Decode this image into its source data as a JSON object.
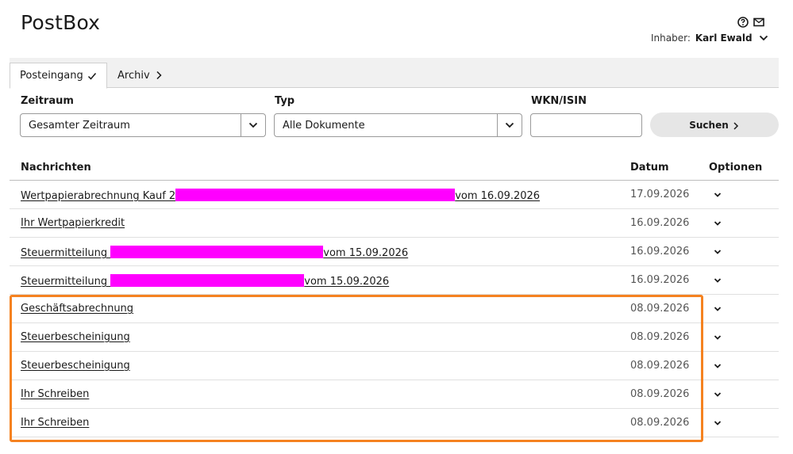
{
  "app": {
    "title": "PostBox"
  },
  "header": {
    "icons": [
      "help-icon",
      "mail-icon"
    ],
    "owner_label": "Inhaber:",
    "owner_name": "Karl Ewald"
  },
  "tabs": [
    {
      "label": "Posteingang",
      "active": true,
      "icon": "check-icon"
    },
    {
      "label": "Archiv",
      "active": false,
      "icon": "chevron-right-icon"
    }
  ],
  "filters": {
    "zeitraum": {
      "label": "Zeitraum",
      "value": "Gesamter Zeitraum"
    },
    "typ": {
      "label": "Typ",
      "value": "Alle Dokumente"
    },
    "wkn": {
      "label": "WKN/ISIN",
      "value": ""
    },
    "search_label": "Suchen"
  },
  "table": {
    "headers": {
      "messages": "Nachrichten",
      "date": "Datum",
      "options": "Optionen"
    },
    "rows": [
      {
        "pre": "Wertpapierabrechnung Kauf 2",
        "redacted": true,
        "post": "vom 16.09.2026",
        "date": "17.09.2026"
      },
      {
        "pre": "Ihr Wertpapierkredit",
        "redacted": false,
        "post": "",
        "date": "16.09.2026"
      },
      {
        "pre": "Steuermitteilung ",
        "redacted": true,
        "post": "vom 15.09.2026",
        "date": "16.09.2026"
      },
      {
        "pre": "Steuermitteilung ",
        "redacted": true,
        "post": "vom 15.09.2026",
        "date": "16.09.2026"
      },
      {
        "pre": "Geschäftsabrechnung",
        "redacted": false,
        "post": "",
        "date": "08.09.2026"
      },
      {
        "pre": "Steuerbescheinigung",
        "redacted": false,
        "post": "",
        "date": "08.09.2026"
      },
      {
        "pre": "Steuerbescheinigung",
        "redacted": false,
        "post": "",
        "date": "08.09.2026"
      },
      {
        "pre": "Ihr Schreiben",
        "redacted": false,
        "post": "",
        "date": "08.09.2026"
      },
      {
        "pre": "Ihr Schreiben",
        "redacted": false,
        "post": "",
        "date": "08.09.2026"
      }
    ]
  },
  "colors": {
    "redaction": "#ff00ff",
    "highlight": "#f58220",
    "button_bg": "#e6e6e6"
  }
}
